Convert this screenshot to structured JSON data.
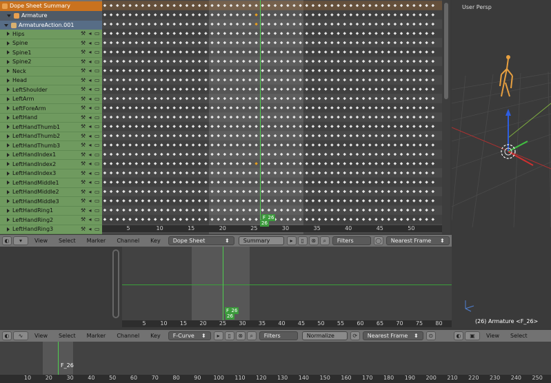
{
  "dopesheet": {
    "summary_label": "Dope Sheet Summary",
    "armature_label": "Armature",
    "action_label": "ArmatureAction.001",
    "channels": [
      "Hips",
      "Spine",
      "Spine1",
      "Spine2",
      "Neck",
      "Head",
      "LeftShoulder",
      "LeftArm",
      "LeftForeArm",
      "LeftHand",
      "LeftHandThumb1",
      "LeftHandThumb2",
      "LeftHandThumb3",
      "LeftHandIndex1",
      "LeftHandIndex2",
      "LeftHandIndex3",
      "LeftHandMiddle1",
      "LeftHandMiddle2",
      "LeftHandMiddle3",
      "LeftHandRing1",
      "LeftHandRing2",
      "LeftHandRing3"
    ],
    "ruler_ticks": [
      "5",
      "10",
      "15",
      "20",
      "25",
      "30",
      "35",
      "40",
      "45",
      "50"
    ],
    "current_frame_label": "F_26",
    "current_frame_box": "26",
    "current_frame": 26
  },
  "dope_header": {
    "view": "View",
    "select": "Select",
    "marker": "Marker",
    "channel": "Channel",
    "key": "Key",
    "mode": "Dope Sheet",
    "summary": "Summary",
    "filters": "Filters",
    "snap": "Nearest Frame"
  },
  "graph": {
    "ruler_ticks": [
      "5",
      "10",
      "15",
      "20",
      "25",
      "30",
      "35",
      "40",
      "45",
      "50",
      "55",
      "60",
      "65",
      "70",
      "75",
      "80"
    ],
    "current_frame_label": "F_26",
    "current_frame_box": "26"
  },
  "graph_header": {
    "view": "View",
    "select": "Select",
    "marker": "Marker",
    "channel": "Channel",
    "key": "Key",
    "mode": "F-Curve",
    "filters": "Filters",
    "normalize": "Normalize",
    "snap": "Nearest Frame"
  },
  "timeline": {
    "ruler_ticks": [
      "10",
      "20",
      "30",
      "40",
      "50",
      "60",
      "70",
      "80",
      "90",
      "100",
      "110",
      "120",
      "130",
      "140",
      "150",
      "160",
      "170",
      "180",
      "190",
      "200",
      "210",
      "220",
      "230",
      "240",
      "250"
    ],
    "current_frame_label": "F_26"
  },
  "view3d": {
    "title": "User Persp",
    "status": "(26) Armature <F_26>",
    "header": {
      "view": "View",
      "select": "Select"
    }
  },
  "colors": {
    "accent": "#c9721e",
    "group": "#6f9a5f",
    "cursor": "#4fcf4f",
    "keyframe": "#e8e8e8"
  }
}
